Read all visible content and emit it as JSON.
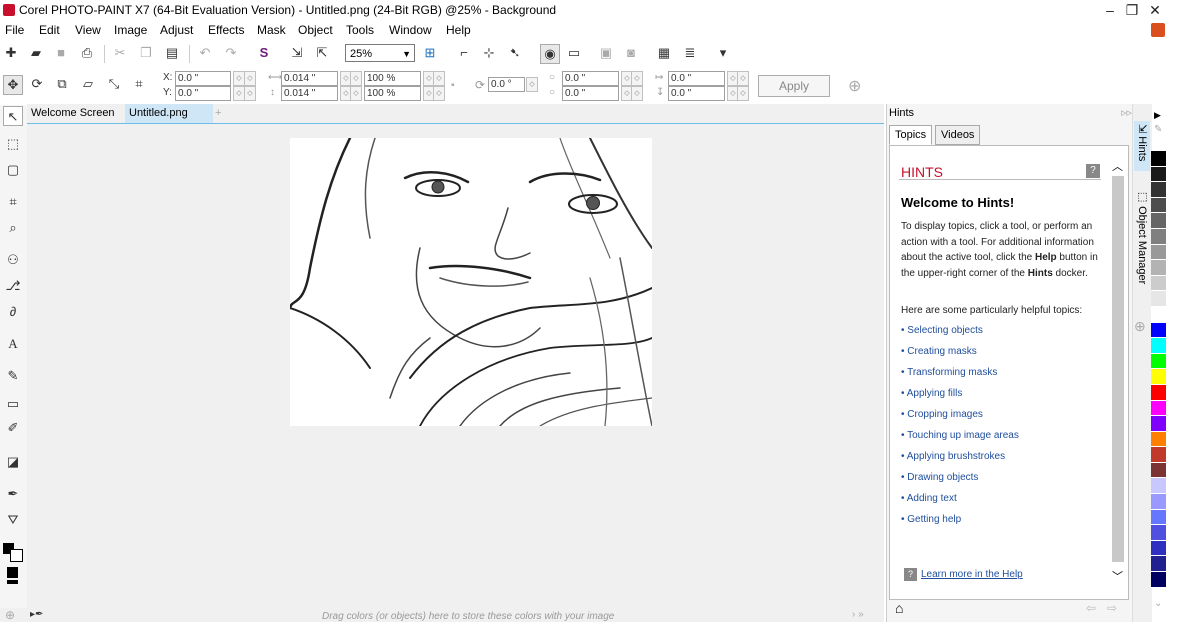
{
  "window": {
    "title": "Corel PHOTO-PAINT X7 (64-Bit Evaluation Version) - Untitled.png (24-Bit RGB) @25% - Background",
    "minimize": "–",
    "restore": "❐",
    "close": "✕"
  },
  "menu": [
    "File",
    "Edit",
    "View",
    "Image",
    "Adjust",
    "Effects",
    "Mask",
    "Object",
    "Tools",
    "Window",
    "Help"
  ],
  "toolbar": {
    "zoom": "25%"
  },
  "propbar": {
    "x_label": "X:",
    "x_value": "0.0 \"",
    "y_label": "Y:",
    "y_value": "0.0 \"",
    "w_value": "0.014 \"",
    "h_value": "0.014 \"",
    "sx_value": "100 %",
    "sy_value": "100 %",
    "rot_value": "0.0 °",
    "cx_value": "0.0 \"",
    "cy_value": "0.0 \"",
    "skx_value": "0.0 \"",
    "sky_value": "0.0 \"",
    "apply": "Apply"
  },
  "tabs": [
    "Welcome Screen",
    "Untitled.png"
  ],
  "status": {
    "hint": "Drag colors (or objects) here to store these colors with your image"
  },
  "hints": {
    "docker_title": "Hints",
    "tabs": [
      "Topics",
      "Videos"
    ],
    "heading": "HINTS",
    "welcome": "Welcome to Hints!",
    "para1_a": "To display topics, click a tool, or perform an action with a tool. For additional information about the active tool, click the ",
    "para1_help": "Help",
    "para1_b": " button in the upper-right corner of the ",
    "para1_hints": "Hints",
    "para1_c": " docker.",
    "para2": "Here are some particularly helpful topics:",
    "links": [
      "Selecting objects",
      "Creating masks",
      "Transforming masks",
      "Applying fills",
      "Cropping images",
      "Touching up image areas",
      "Applying brushstrokes",
      "Drawing objects",
      "Adding text",
      "Getting help"
    ],
    "learn_more": "Learn more in the Help"
  },
  "side_tabs": [
    "Hints",
    "Object Manager"
  ],
  "palette": [
    "#000000",
    "#1a1a1a",
    "#333333",
    "#4d4d4d",
    "#666666",
    "#808080",
    "#999999",
    "#b3b3b3",
    "#cccccc",
    "#e6e6e6",
    "#ffffff",
    "#0000ff",
    "#00ffff",
    "#00ff00",
    "#ffff00",
    "#ff0000",
    "#ff00ff",
    "#8000ff",
    "#ff8000",
    "#c0392b",
    "#7b3333",
    "#c8c8ff",
    "#9999ff",
    "#6677ff",
    "#5050e0",
    "#3030c0",
    "#202090",
    "#000060"
  ]
}
